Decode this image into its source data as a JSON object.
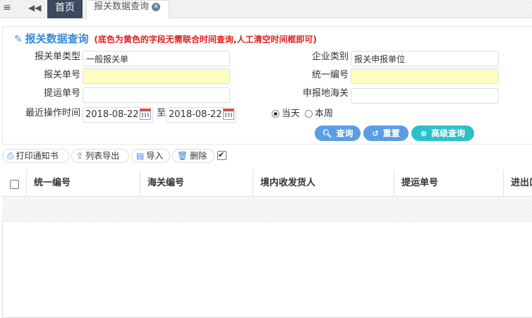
{
  "tabs": {
    "menu_icon": "hamburger-icon",
    "back_icon": "double-left-arrow-icon",
    "home": "首页",
    "active": "报关数据查询"
  },
  "panel": {
    "title": "报关数据查询",
    "note": "(底色为黄色的字段无需联合时间查询,人工清空时间框即可)",
    "fields": {
      "decl_type_label": "报关单类型",
      "decl_type_value": "一般报关单",
      "company_type_label": "企业类别",
      "company_type_value": "报关申报单位",
      "decl_no_label": "报关单号",
      "unified_no_label": "统一编号",
      "bl_no_label": "提运单号",
      "customs_label": "申报地海关",
      "last_op_label": "最近操作时间",
      "date_from": "2018-08-22",
      "date_sep": "至",
      "date_to": "2018-08-22"
    },
    "range": {
      "today": "当天",
      "week": "本周",
      "selected": "today"
    },
    "buttons": {
      "search": "查询",
      "reset": "重置",
      "advanced": "高级查询"
    }
  },
  "toolbar": {
    "print": "打印通知书",
    "export": "列表导出",
    "import": "导入",
    "delete": "删除",
    "checked": true
  },
  "grid": {
    "columns": [
      "统一编号",
      "海关编号",
      "境内收发货人",
      "提运单号",
      "进出口"
    ]
  },
  "colors": {
    "accent": "#3a88d8",
    "warning": "#e01f1f",
    "highlight_field": "#fdfdc1",
    "tab_dark": "#3b4a5e",
    "teal_button": "#2ec0c9"
  }
}
